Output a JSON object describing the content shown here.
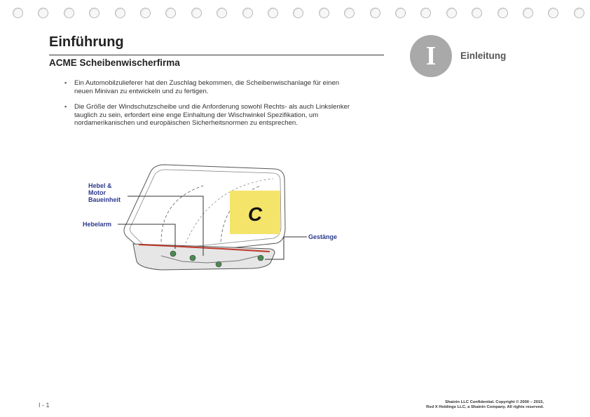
{
  "page": {
    "title": "Einführung",
    "subtitle": "ACME Scheibenwischerfirma",
    "badge_letter": "I",
    "section_label": "Einleitung",
    "page_number": "I - 1"
  },
  "bullets": [
    "Ein Automobilzulieferer hat den Zuschlag bekommen, die Scheibenwischanlage für einen neuen Minivan zu entwickeln und zu fertigen.",
    "Die Größe der Windschutzscheibe und die Anforderung sowohl Rechts- als auch Linkslenker tauglich zu sein, erfordert eine enge Einhaltung der Wischwinkel Spezifikation, um nordamerikanischen und europäischen Sicherheitsnormen zu entsprechen."
  ],
  "diagram": {
    "labels": {
      "hebel_line1": "Hebel &",
      "hebel_line2": "Motor",
      "hebel_line3": "Baueinheit",
      "hebelarm": "Hebelarm",
      "gestaenge": "Gestänge"
    },
    "marker_letter": "C"
  },
  "footer": {
    "line1": "Shainin LLC Confidential. Copyright © 2000 – 2015,",
    "line2": "Red X Holdings LLC, a Shainin Company. All rights reserved."
  },
  "colors": {
    "label_blue": "#2c3a8c",
    "marker_yellow": "#f5e46a",
    "badge_gray": "#a9a9a9"
  }
}
